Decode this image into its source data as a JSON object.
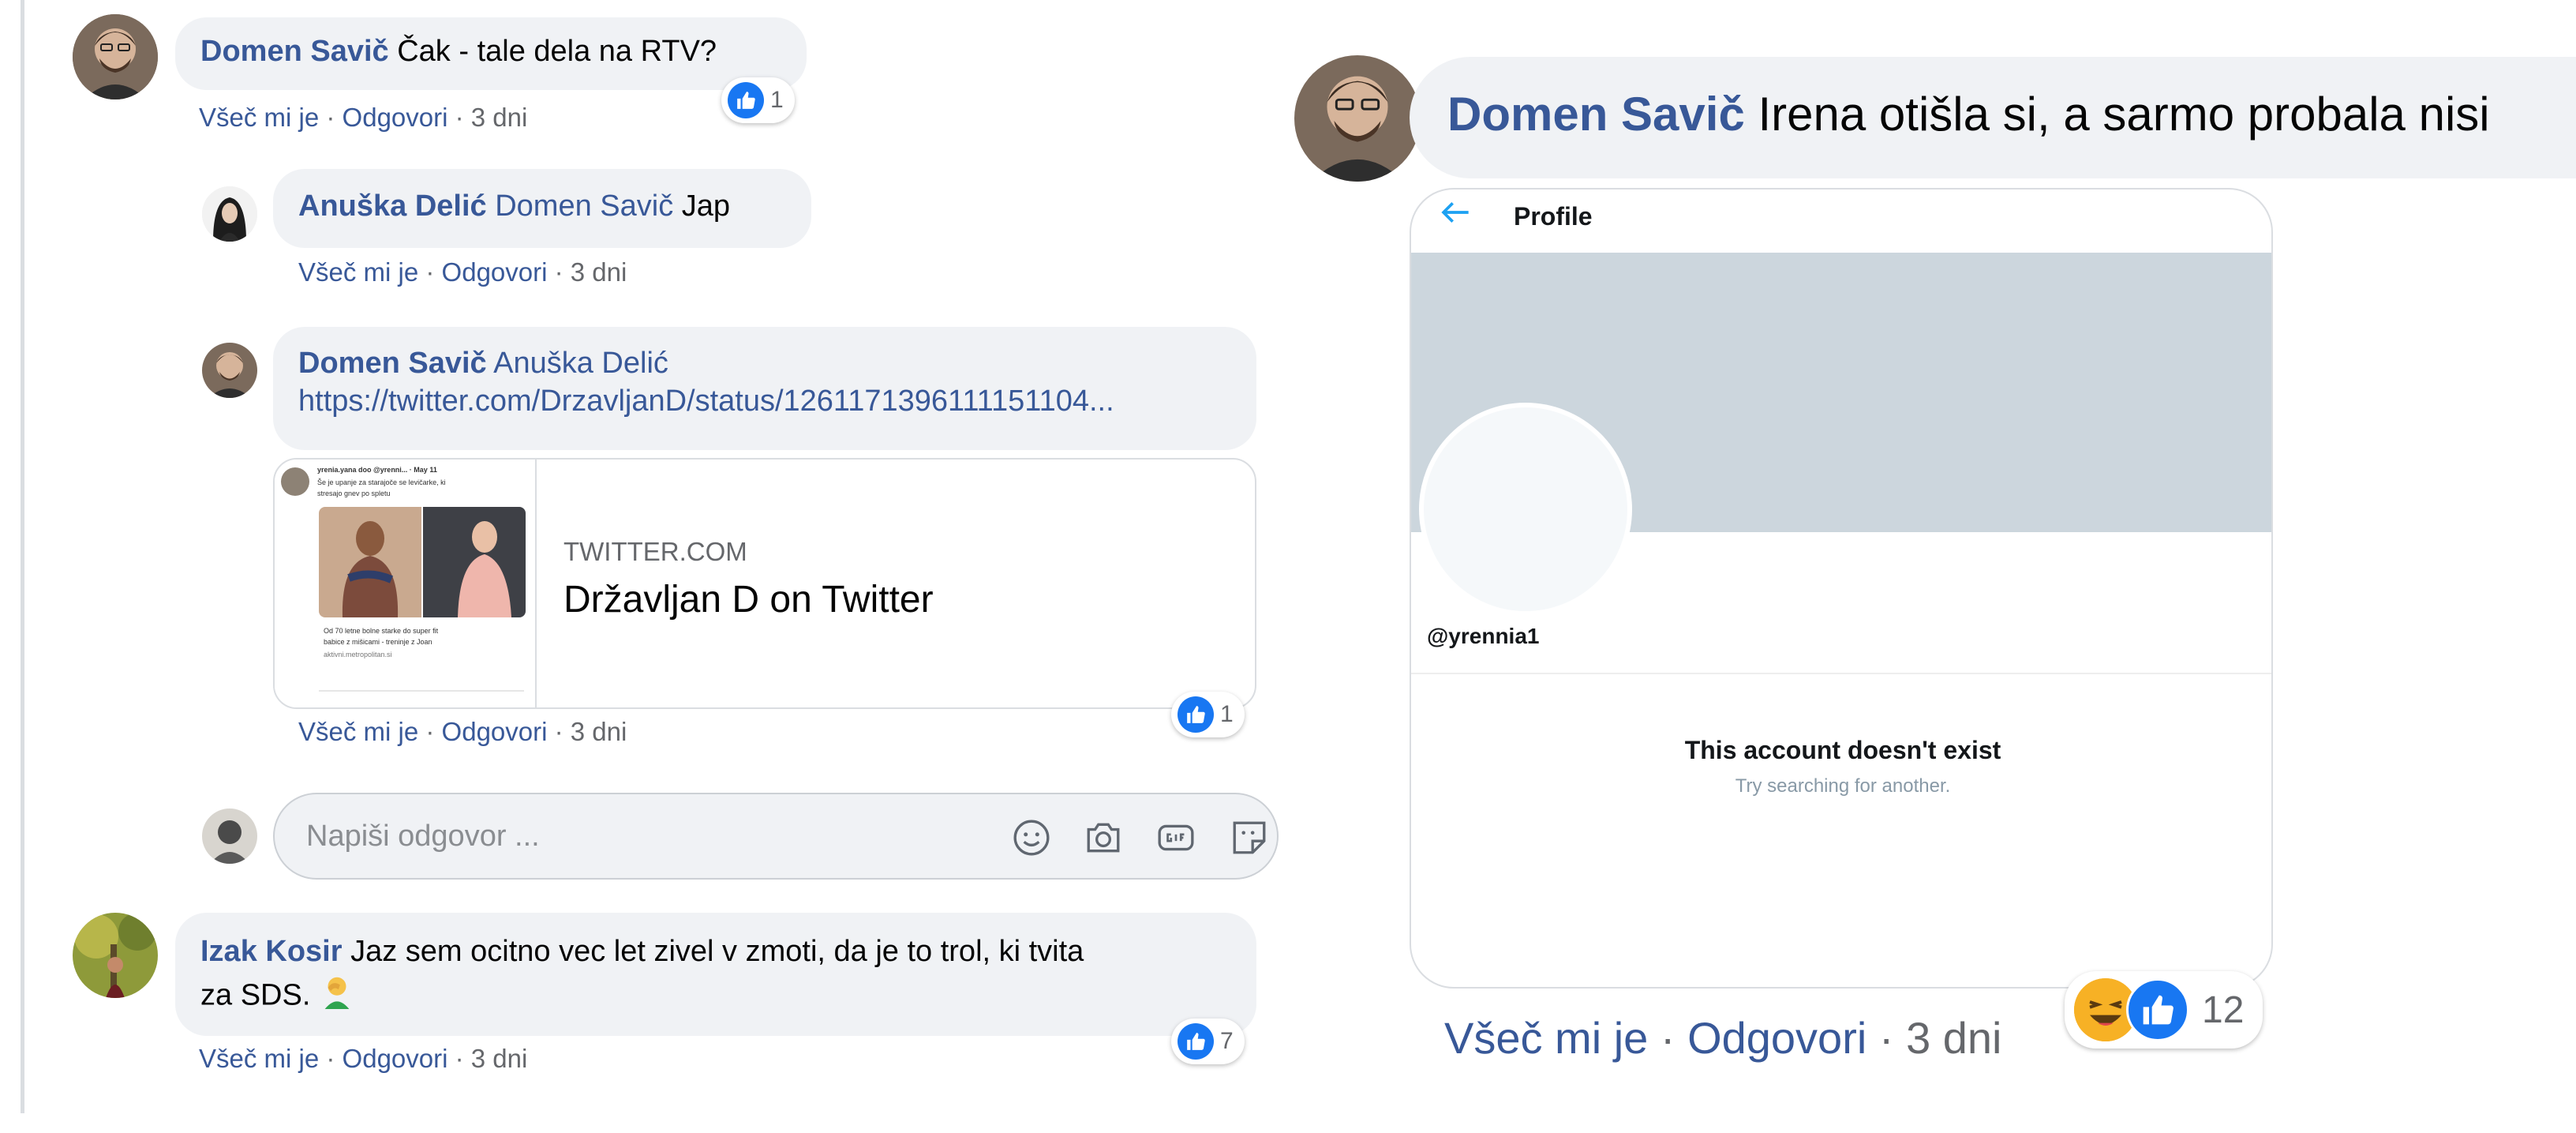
{
  "left": {
    "comment1": {
      "author": "Domen Savič",
      "text": "Čak - tale dela na RTV?",
      "like_label": "Všeč mi je",
      "reply_label": "Odgovori",
      "age": "3 dni",
      "reaction_count": "1"
    },
    "reply1": {
      "author": "Anuška Delić",
      "tag": "Domen Savič",
      "text": "Jap",
      "like_label": "Všeč mi je",
      "reply_label": "Odgovori",
      "age": "3 dni"
    },
    "reply2": {
      "author": "Domen Savič",
      "tag": "Anuška Delić",
      "url": "https://twitter.com/DrzavljanD/status/1261171396111151104...",
      "preview": {
        "domain": "TWITTER.COM",
        "title": "Državljan D on Twitter",
        "thumb_header": "yrenia.yana doo  @yrenni...  · May 11",
        "thumb_line1": "Še je upanje za starajoče se levičarke, ki",
        "thumb_line2": "stresajo gnev po spletu",
        "thumb_caption1": "Od 70 letne bolne starke do super fit",
        "thumb_caption2": "babice z mišicami - treninje z Joan",
        "thumb_link": "aktivni.metropolitan.si"
      },
      "like_label": "Všeč mi je",
      "reply_label": "Odgovori",
      "age": "3 dni",
      "reaction_count": "1"
    },
    "reply_input": {
      "placeholder": "Napiši odgovor ..."
    },
    "comment2": {
      "author": "Izak Kosir",
      "text_line1": "Jaz sem ocitno vec let zivel v zmoti, da je to trol, ki tvita",
      "text_line2": "za SDS.",
      "like_label": "Všeč mi je",
      "reply_label": "Odgovori",
      "age": "3 dni",
      "reaction_count": "7"
    }
  },
  "right": {
    "comment": {
      "author": "Domen Savič",
      "text": "Irena otišla si, a sarmo probala nisi",
      "like_label": "Všeč mi je",
      "reply_label": "Odgovori",
      "age": "3 dni",
      "reaction_count": "12"
    },
    "screenshot": {
      "header": "Profile",
      "handle": "@yrennia1",
      "message": "This account doesn't exist",
      "submessage": "Try searching for another."
    }
  },
  "colors": {
    "link": "#385898",
    "like": "#1877f2",
    "bubble": "#f0f2f5",
    "muted": "#65676b"
  }
}
